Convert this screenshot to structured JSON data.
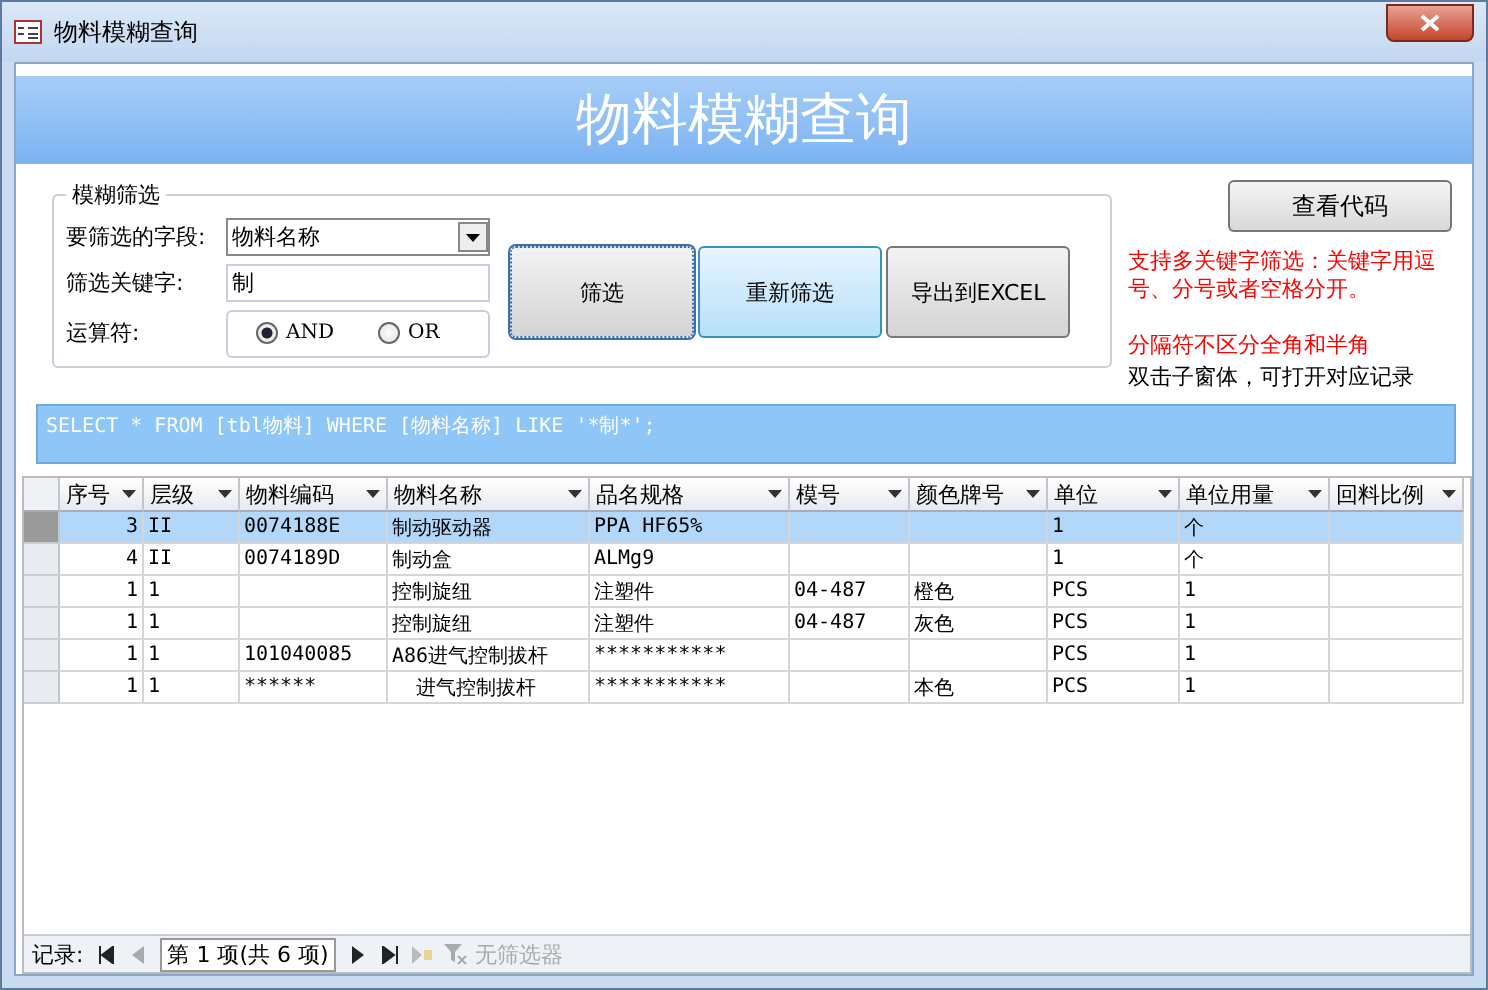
{
  "window": {
    "title": "物料模糊查询"
  },
  "header": {
    "title": "物料模糊查询"
  },
  "filter": {
    "legend": "模糊筛选",
    "field_label": "要筛选的字段:",
    "field_value": "物料名称",
    "keyword_label": "筛选关键字:",
    "keyword_value": "制",
    "operator_label": "运算符:",
    "operators": [
      {
        "label": "AND",
        "selected": true
      },
      {
        "label": "OR",
        "selected": false
      }
    ]
  },
  "buttons": [
    {
      "label": "筛选",
      "kind": "focused"
    },
    {
      "label": "重新筛选",
      "kind": "hover"
    },
    {
      "label": "导出到EXCEL",
      "kind": "normal"
    }
  ],
  "view_code_button": "查看代码",
  "notes": [
    {
      "text": "支持多关键字筛选：关键字用逗号、分号或者空格分开。",
      "kind": "warning"
    },
    {
      "text": "分隔符不区分全角和半角",
      "kind": "warning"
    },
    {
      "text": "双击子窗体，可打开对应记录",
      "kind": "info"
    }
  ],
  "sql": "SELECT * FROM [tbl物料] WHERE [物料名称] LIKE '*制*';",
  "table": {
    "columns": [
      "序号",
      "层级",
      "物料编码",
      "物料名称",
      "品名规格",
      "模号",
      "颜色牌号",
      "单位",
      "单位用量",
      "回料比例"
    ],
    "rows": [
      {
        "selected": true,
        "cells": [
          "3",
          "II",
          "0074188E",
          "制动驱动器",
          "PPA HF65%",
          "",
          "",
          "1",
          "个",
          ""
        ]
      },
      {
        "selected": false,
        "cells": [
          "4",
          "II",
          "0074189D",
          "制动盒",
          "ALMg9",
          "",
          "",
          "1",
          "个",
          ""
        ]
      },
      {
        "selected": false,
        "cells": [
          "1",
          "1",
          "",
          "控制旋纽",
          "注塑件",
          "04-487",
          "橙色",
          "PCS",
          "1",
          ""
        ]
      },
      {
        "selected": false,
        "cells": [
          "1",
          "1",
          "",
          "控制旋纽",
          "注塑件",
          "04-487",
          "灰色",
          "PCS",
          "1",
          ""
        ]
      },
      {
        "selected": false,
        "cells": [
          "1",
          "1",
          "101040085",
          "A86进气控制拔杆",
          "***********",
          "",
          "",
          "PCS",
          "1",
          ""
        ]
      },
      {
        "selected": false,
        "cells": [
          "1",
          "1",
          "******",
          "  进气控制拔杆",
          "***********",
          "",
          "本色",
          "PCS",
          "1",
          ""
        ]
      }
    ]
  },
  "navigator": {
    "label": "记录:",
    "position": "第 1 项(共 6 项)",
    "filter": "无筛选器"
  }
}
